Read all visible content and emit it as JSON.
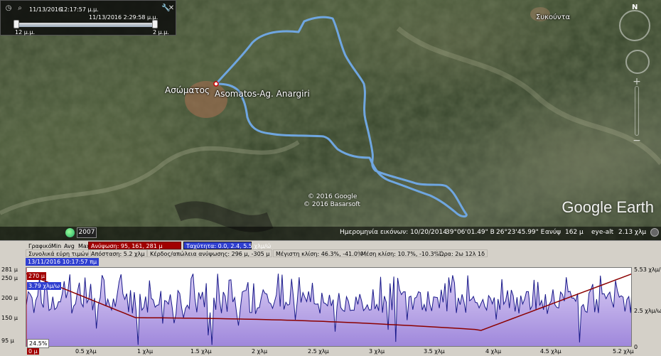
{
  "time_slider": {
    "start_date": "11/13/2016",
    "start_time": "12:17:57 μ.μ.",
    "end_datetime": "11/13/2016    2:29:58 μ.μ.",
    "left_tick": "12 μ.μ.",
    "right_tick": "2 μ.μ."
  },
  "map": {
    "village_label": "Ασώματος",
    "track_label": "Asomatos-Ag. Anargiri",
    "village_ne_label": "Συκούντα",
    "copyright_1": "© 2016 Google",
    "copyright_2": "© 2016 Basarsoft",
    "logo_text": "Google Earth",
    "compass_n": "N"
  },
  "status_bar": {
    "year": "2007",
    "imagery_date": "Ημερομηνία εικόνων: 10/20/2014",
    "latitude": "39°06'01.49\" Β",
    "longitude": "26°23'45.99\" Ε",
    "elevation_label": "ανύψ",
    "elevation": "162 μ",
    "eye_alt_label": "eye-alt",
    "eye_alt": "2.13 χλμ"
  },
  "stats": {
    "row1": {
      "graph_label": "Γραφικό",
      "min": "Min",
      "avg": "Avg",
      "max": "Max",
      "elevation": "Ανύψωση: 95, 161, 281 μ",
      "speed": "Ταχύτητα: 0.0, 2.4, 5.5 χλμ/ώ"
    },
    "row2": {
      "totals_label": "Συνολικά εύρη τιμών",
      "distance": "Απόσταση: 5.2 χλμ",
      "gain_loss": "Κέρδος/απώλεια ανύψωσης: 296 μ, -305 μ",
      "max_slope": "Μέγιστη κλίση: 46.3%, -41.0%",
      "avg_slope": "Μέση κλίση: 10.7%, -10.3%",
      "time": "Ώρα: 2ω 12λ 1δ"
    }
  },
  "profile": {
    "date_tag": "13/11/2016 10:17:57 πμ",
    "cursor_elevation": "270 μ",
    "cursor_speed": "3.79 χλμ/ω",
    "cursor_slope": "24.5%",
    "left_axis": [
      "281 μ",
      "250 μ",
      "200 μ",
      "150 μ",
      "95 μ"
    ],
    "right_axis": [
      "5.53 χλμ/ω",
      "2.5 χλμ/ω",
      "0"
    ],
    "x_axis": [
      "0 μ",
      "0.5 χλμ",
      "1 χλμ",
      "1.5 χλμ",
      "2 χλμ",
      "2.5 χλμ",
      "3 χλμ",
      "3.5 χλμ",
      "4 χλμ",
      "4.5 χλμ",
      "5.2 χλμ"
    ]
  },
  "colors": {
    "track": "#6fa6e0",
    "elevation_line": "#8b0000",
    "speed_line": "#1a1a8a",
    "speed_fill": "#b9a8e6"
  }
}
